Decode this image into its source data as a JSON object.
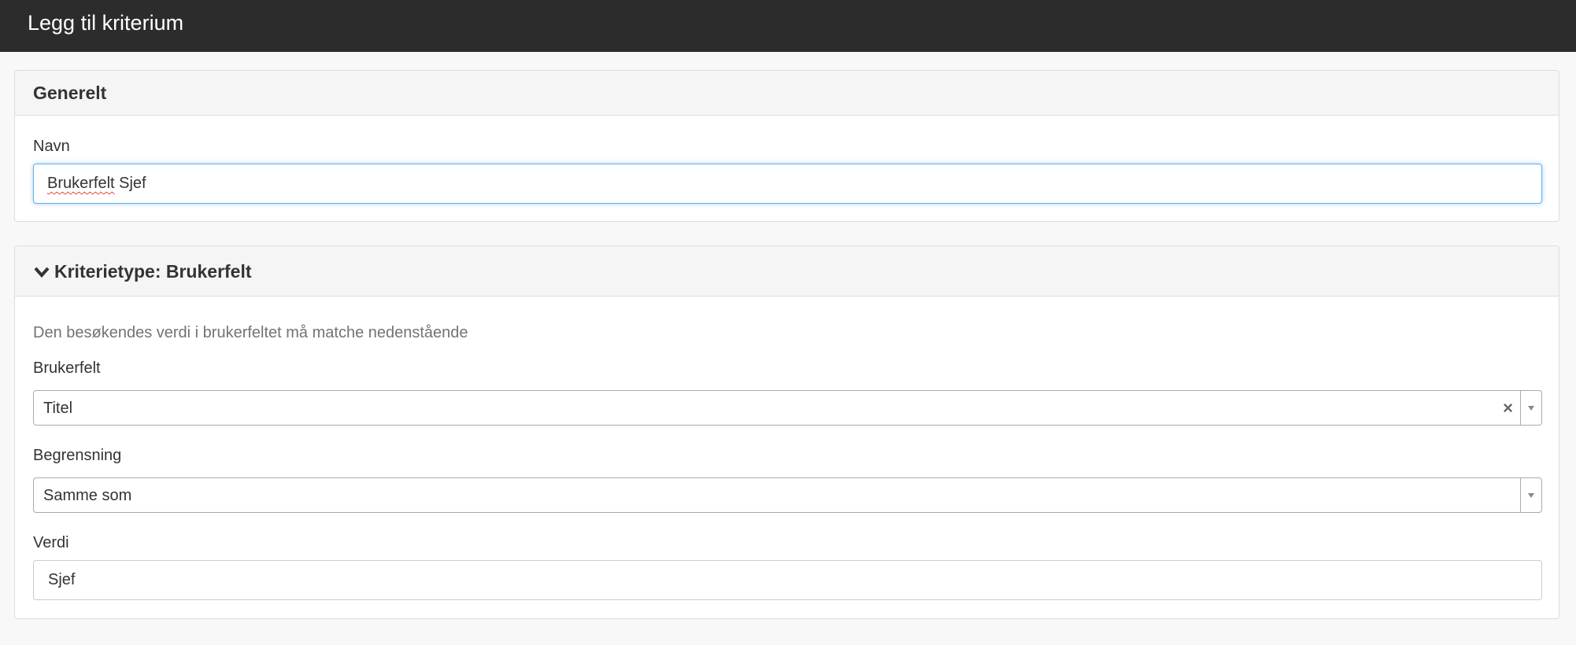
{
  "header": {
    "title": "Legg til kriterium"
  },
  "general_panel": {
    "heading": "Generelt",
    "name_label": "Navn",
    "name_value_word1": "Brukerfelt",
    "name_value_word2": " Sjef"
  },
  "criteria_panel": {
    "heading": "Kriterietype: Brukerfelt",
    "description": "Den besøkendes verdi i brukerfeltet må matche nedenstående",
    "userfield_label": "Brukerfelt",
    "userfield_value": "Titel",
    "restriction_label": "Begrensning",
    "restriction_value": "Samme som",
    "value_label": "Verdi",
    "value_value": "Sjef"
  },
  "icons": {
    "collapse": "chevron-down-icon",
    "clear": "clear-x-icon",
    "dropdown": "dropdown-arrow-icon"
  },
  "colors": {
    "header_bg": "#2c2c2c",
    "focus_border": "#66afe9"
  }
}
